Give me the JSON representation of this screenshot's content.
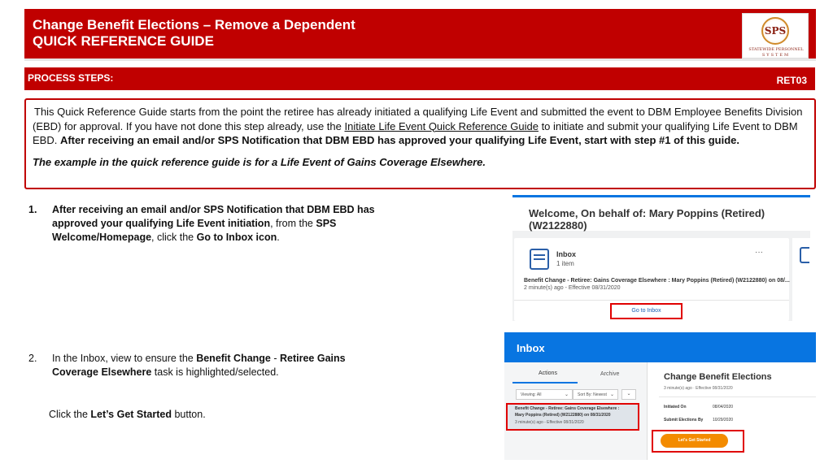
{
  "header": {
    "title_line1": "Change Benefit Elections – Remove a Dependent",
    "title_line2": "QUICK REFERENCE GUIDE",
    "logo_initials": "SPS",
    "logo_line1": "STATEWIDE PERSONNEL",
    "logo_line2": "SYSTEM"
  },
  "process_bar": {
    "label": "PROCESS STEPS:",
    "code": "RET03"
  },
  "intro": {
    "text1": "This Quick Reference Guide starts from the point the retiree has already initiated a qualifying Life Event and submitted the event to DBM Employee Benefits Division (EBD) for approval.  If you have not done this step already, use the ",
    "link": "Initiate Life Event Quick Reference Guide",
    "text2": " to initiate and submit your qualifying Life Event to DBM EBD.  ",
    "bold": "After receiving an email and/or SPS Notification that DBM EBD has approved your qualifying Life Event, start with step #1 of this guide.",
    "example": "The example in the quick reference guide is for a Life Event of Gains Coverage Elsewhere."
  },
  "step1": {
    "num": "1.",
    "bold1": "After receiving an email and/or SPS Notification that DBM EBD has approved your qualifying Life Event initiation",
    "text1": ", from the ",
    "bold2": "SPS Welcome/Homepage",
    "text2": ", click the ",
    "bold3": "Go to Inbox icon",
    "text3": "."
  },
  "step2": {
    "num": "2.",
    "text1": "In the Inbox, view to ensure the ",
    "bold1": "Benefit Change",
    "text2": " - ",
    "bold2": "Retiree Gains Coverage Elsewhere",
    "text3": " task is highlighted/selected.",
    "click_text1": "Click the ",
    "click_bold": "Let’s Get Started",
    "click_text2": " button."
  },
  "screenshot1": {
    "welcome": "Welcome, On behalf of: Mary Poppins (Retired) (W2122880)",
    "inbox_title": "Inbox",
    "inbox_count": "1 item",
    "ellipsis": "···",
    "task": "Benefit Change - Retiree: Gains Coverage Elsewhere : Mary Poppins (Retired) (W2122880) on 08/...",
    "meta": "2 minute(s) ago - Effective 08/31/2020",
    "goto_button": "Go to Inbox"
  },
  "screenshot2": {
    "title": "Inbox",
    "tab_actions": "Actions",
    "tab_archive": "Archive",
    "viewing": "Viewing: All",
    "sort": "Sort By: Newest",
    "chevron": "⌄",
    "task_line1": "Benefit Change - Retiree: Gains Coverage Elsewhere :",
    "task_line2": "Mary Poppins (Retired) (W2122880) on 08/31/2020",
    "task_line3": "3 minute(s) ago - Effective 08/31/2020",
    "detail_title": "Change Benefit Elections",
    "detail_meta": "3 minute(s) ago · Effective 08/31/2020",
    "initiated_label": "Initiated On",
    "initiated_value": "08/04/2020",
    "submit_label": "Submit Elections By",
    "submit_value": "10/29/2020",
    "started_button": "Let's Get Started"
  }
}
